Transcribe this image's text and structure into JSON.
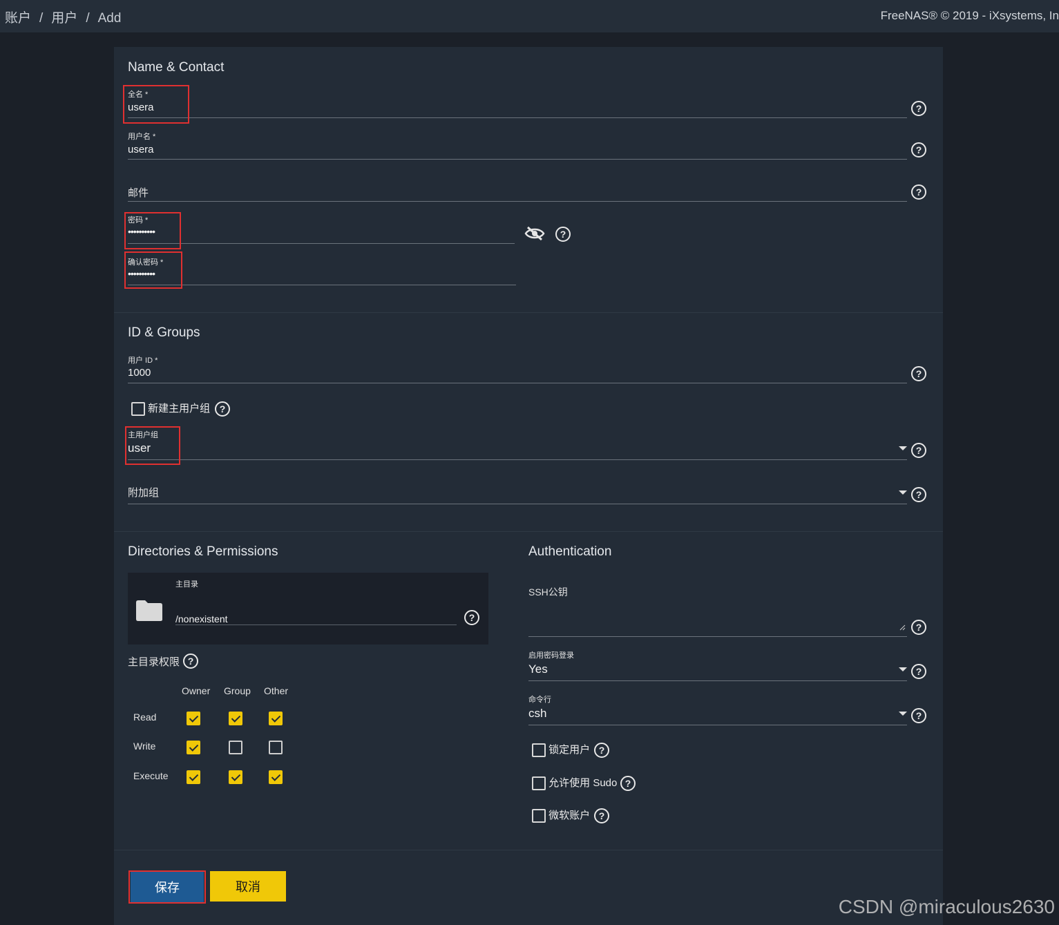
{
  "breadcrumb": {
    "items": [
      "账户",
      "用户",
      "Add"
    ],
    "separator": "/"
  },
  "copyright": "FreeNAS® © 2019 - iXsystems, In",
  "sections": {
    "name_contact": "Name & Contact",
    "id_groups": "ID & Groups",
    "directories": "Directories & Permissions",
    "authentication": "Authentication"
  },
  "fields": {
    "full_name": {
      "label": "全名 *",
      "value": "usera"
    },
    "username": {
      "label": "用户名 *",
      "value": "usera"
    },
    "email": {
      "placeholder": "邮件"
    },
    "password": {
      "label": "密码 *",
      "value": "••••••••••"
    },
    "confirm_password": {
      "label": "确认密码 *",
      "value": "••••••••••"
    },
    "user_id": {
      "label": "用户 ID *",
      "value": "1000"
    },
    "new_primary_group": {
      "label": "新建主用户组",
      "checked": false
    },
    "primary_group": {
      "label": "主用户组",
      "value": "user"
    },
    "aux_groups": {
      "placeholder": "附加组"
    },
    "home_dir": {
      "label": "主目录",
      "value": "/nonexistent"
    },
    "home_perms": {
      "label": "主目录权限"
    },
    "ssh_key": {
      "placeholder": "SSH公钥"
    },
    "password_login": {
      "label": "启用密码登录",
      "value": "Yes"
    },
    "shell": {
      "label": "命令行",
      "value": "csh"
    },
    "lock_user": {
      "label": "锁定用户",
      "checked": false
    },
    "sudo": {
      "label": "允许使用 Sudo",
      "checked": false
    },
    "microsoft_account": {
      "label": "微软账户",
      "checked": false
    }
  },
  "permissions": {
    "columns": [
      "Owner",
      "Group",
      "Other"
    ],
    "rows": [
      {
        "label": "Read",
        "values": [
          true,
          true,
          true
        ]
      },
      {
        "label": "Write",
        "values": [
          true,
          false,
          false
        ]
      },
      {
        "label": "Execute",
        "values": [
          true,
          true,
          true
        ]
      }
    ]
  },
  "buttons": {
    "save": "保存",
    "cancel": "取消"
  },
  "watermark": "CSDN @miraculous2630",
  "colors": {
    "accent_yellow": "#f0c808",
    "save_blue": "#1e5a93",
    "highlight_red": "#e03030"
  },
  "icons": {
    "help": "?"
  }
}
